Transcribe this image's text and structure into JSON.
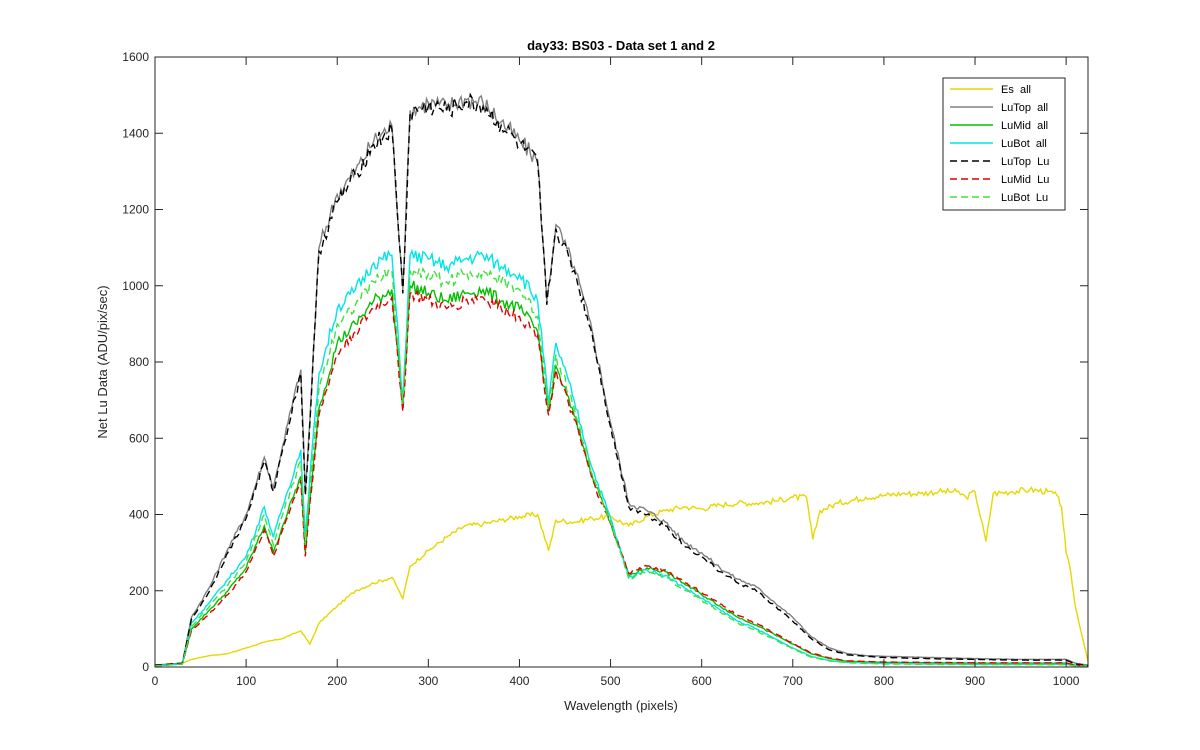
{
  "chart_data": {
    "type": "line",
    "title": "day33: BS03 - Data set 1 and 2",
    "xlabel": "Wavelength (pixels)",
    "ylabel": "Net Lu Data (ADU/pix/sec)",
    "xlim": [
      0,
      1024
    ],
    "ylim": [
      0,
      1600
    ],
    "xticks": [
      0,
      100,
      200,
      300,
      400,
      500,
      600,
      700,
      800,
      900,
      1000
    ],
    "yticks": [
      0,
      200,
      400,
      600,
      800,
      1000,
      1200,
      1400,
      1600
    ],
    "grid": false,
    "legend_position": "top-right",
    "series": [
      {
        "name": "Es  all",
        "color": "#e6d800",
        "dash": "solid",
        "x": [
          0,
          30,
          40,
          60,
          80,
          100,
          120,
          140,
          160,
          170,
          180,
          200,
          220,
          240,
          260,
          272,
          280,
          300,
          320,
          340,
          360,
          380,
          400,
          420,
          432,
          440,
          460,
          480,
          500,
          520,
          540,
          560,
          580,
          600,
          620,
          640,
          660,
          680,
          700,
          715,
          722,
          730,
          750,
          780,
          800,
          820,
          840,
          860,
          880,
          890,
          900,
          912,
          920,
          940,
          960,
          980,
          990,
          995,
          1000,
          1005,
          1010,
          1024
        ],
        "y": [
          5,
          10,
          20,
          30,
          35,
          50,
          65,
          75,
          95,
          60,
          115,
          160,
          200,
          220,
          235,
          180,
          265,
          305,
          340,
          370,
          375,
          385,
          395,
          400,
          305,
          385,
          380,
          390,
          395,
          370,
          395,
          410,
          420,
          415,
          425,
          430,
          430,
          435,
          445,
          445,
          335,
          410,
          430,
          445,
          450,
          455,
          455,
          460,
          460,
          445,
          460,
          330,
          455,
          460,
          465,
          460,
          450,
          420,
          300,
          250,
          160,
          15
        ]
      },
      {
        "name": "LuTop  all",
        "color": "#808080",
        "dash": "solid",
        "x": [
          0,
          30,
          40,
          60,
          80,
          100,
          120,
          130,
          140,
          160,
          165,
          170,
          180,
          200,
          220,
          240,
          260,
          272,
          280,
          300,
          320,
          340,
          360,
          380,
          400,
          420,
          430,
          440,
          460,
          480,
          500,
          520,
          540,
          560,
          580,
          600,
          620,
          640,
          660,
          680,
          700,
          720,
          740,
          760,
          780,
          800,
          850,
          900,
          950,
          1000,
          1010,
          1024
        ],
        "y": [
          5,
          10,
          130,
          210,
          310,
          400,
          550,
          470,
          580,
          780,
          460,
          650,
          1100,
          1240,
          1300,
          1380,
          1420,
          990,
          1460,
          1480,
          1470,
          1490,
          1480,
          1430,
          1380,
          1330,
          960,
          1160,
          1050,
          880,
          640,
          430,
          410,
          380,
          330,
          300,
          260,
          230,
          210,
          170,
          130,
          80,
          50,
          35,
          30,
          28,
          25,
          22,
          20,
          20,
          10,
          5
        ]
      },
      {
        "name": "LuMid  all",
        "color": "#00c000",
        "dash": "solid",
        "x": [
          0,
          30,
          40,
          60,
          80,
          100,
          120,
          130,
          140,
          160,
          165,
          170,
          180,
          200,
          220,
          240,
          260,
          272,
          280,
          300,
          320,
          340,
          360,
          380,
          400,
          420,
          432,
          440,
          460,
          480,
          500,
          520,
          540,
          560,
          580,
          600,
          620,
          640,
          660,
          680,
          700,
          720,
          740,
          760,
          800,
          850,
          900,
          950,
          1000,
          1010,
          1024
        ],
        "y": [
          3,
          8,
          100,
          150,
          200,
          260,
          370,
          300,
          370,
          500,
          300,
          440,
          680,
          850,
          900,
          960,
          990,
          680,
          1000,
          980,
          960,
          980,
          990,
          960,
          940,
          880,
          670,
          790,
          660,
          500,
          380,
          240,
          260,
          250,
          220,
          190,
          160,
          130,
          110,
          85,
          60,
          35,
          22,
          15,
          12,
          11,
          10,
          10,
          10,
          5,
          3
        ]
      },
      {
        "name": "LuBot  all",
        "color": "#00e5e5",
        "dash": "solid",
        "x": [
          0,
          30,
          40,
          60,
          80,
          100,
          120,
          130,
          140,
          160,
          165,
          170,
          180,
          200,
          220,
          240,
          260,
          272,
          280,
          300,
          320,
          340,
          360,
          380,
          400,
          420,
          432,
          440,
          460,
          480,
          500,
          520,
          540,
          560,
          580,
          600,
          620,
          640,
          660,
          680,
          700,
          720,
          740,
          760,
          800,
          850,
          900,
          950,
          1000,
          1010,
          1024
        ],
        "y": [
          3,
          8,
          115,
          170,
          230,
          290,
          420,
          340,
          420,
          570,
          340,
          500,
          770,
          940,
          990,
          1060,
          1080,
          700,
          1080,
          1070,
          1050,
          1070,
          1080,
          1050,
          1030,
          960,
          690,
          850,
          700,
          520,
          390,
          235,
          255,
          240,
          210,
          180,
          150,
          120,
          100,
          75,
          50,
          28,
          17,
          12,
          9,
          8,
          7,
          7,
          7,
          4,
          2
        ]
      },
      {
        "name": "LuTop  Lu",
        "color": "#000000",
        "dash": "dashed",
        "x": [
          0,
          30,
          40,
          60,
          80,
          100,
          120,
          130,
          140,
          160,
          165,
          170,
          180,
          200,
          220,
          240,
          260,
          272,
          280,
          300,
          320,
          340,
          360,
          380,
          400,
          420,
          430,
          440,
          460,
          480,
          500,
          520,
          540,
          560,
          580,
          600,
          620,
          640,
          660,
          680,
          700,
          720,
          740,
          760,
          780,
          800,
          850,
          900,
          950,
          1000,
          1010,
          1024
        ],
        "y": [
          5,
          10,
          125,
          200,
          300,
          390,
          540,
          460,
          570,
          770,
          450,
          640,
          1090,
          1220,
          1290,
          1370,
          1410,
          980,
          1450,
          1470,
          1460,
          1480,
          1470,
          1420,
          1370,
          1320,
          950,
          1150,
          1040,
          870,
          630,
          420,
          400,
          370,
          320,
          290,
          250,
          220,
          200,
          160,
          120,
          75,
          45,
          32,
          28,
          25,
          22,
          20,
          18,
          18,
          8,
          4
        ]
      },
      {
        "name": "LuMid  Lu",
        "color": "#e00000",
        "dash": "dashed",
        "x": [
          0,
          30,
          40,
          60,
          80,
          100,
          120,
          130,
          140,
          160,
          165,
          170,
          180,
          200,
          220,
          240,
          260,
          272,
          280,
          300,
          320,
          340,
          360,
          380,
          400,
          420,
          432,
          440,
          460,
          480,
          500,
          520,
          540,
          560,
          580,
          600,
          620,
          640,
          660,
          680,
          700,
          720,
          740,
          760,
          800,
          850,
          900,
          950,
          1000,
          1010,
          1024
        ],
        "y": [
          3,
          8,
          95,
          140,
          190,
          250,
          360,
          290,
          360,
          490,
          290,
          430,
          660,
          820,
          880,
          940,
          970,
          670,
          980,
          960,
          940,
          960,
          970,
          940,
          920,
          870,
          660,
          780,
          650,
          490,
          375,
          245,
          265,
          255,
          225,
          195,
          165,
          135,
          115,
          88,
          62,
          37,
          24,
          16,
          13,
          12,
          11,
          11,
          11,
          5,
          3
        ]
      },
      {
        "name": "LuBot  Lu",
        "color": "#40e040",
        "dash": "dashed",
        "x": [
          0,
          30,
          40,
          60,
          80,
          100,
          120,
          130,
          140,
          160,
          165,
          170,
          180,
          200,
          220,
          240,
          260,
          272,
          280,
          300,
          320,
          340,
          360,
          380,
          400,
          420,
          432,
          440,
          460,
          480,
          500,
          520,
          540,
          560,
          580,
          600,
          620,
          640,
          660,
          680,
          700,
          720,
          740,
          760,
          800,
          850,
          900,
          950,
          1000,
          1010,
          1024
        ],
        "y": [
          3,
          8,
          105,
          160,
          215,
          275,
          400,
          320,
          400,
          540,
          320,
          470,
          730,
          900,
          950,
          1010,
          1040,
          690,
          1040,
          1030,
          1010,
          1030,
          1040,
          1010,
          990,
          920,
          680,
          820,
          680,
          505,
          380,
          230,
          250,
          235,
          205,
          175,
          145,
          115,
          95,
          72,
          48,
          26,
          16,
          11,
          8,
          7,
          6,
          6,
          6,
          3,
          2
        ]
      }
    ]
  }
}
